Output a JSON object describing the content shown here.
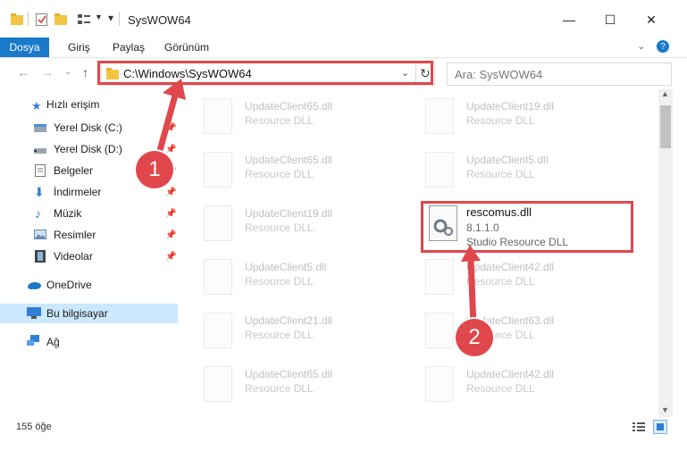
{
  "window": {
    "title": "SysWOW64",
    "minimize_glyph": "—",
    "maximize_glyph": "☐",
    "close_glyph": "✕"
  },
  "ribbon": {
    "tabs": [
      "Dosya",
      "Giriş",
      "Paylaş",
      "Görünüm"
    ],
    "accent": "#1979ca"
  },
  "address_bar": {
    "path": "C:\\Windows\\SysWOW64"
  },
  "search": {
    "placeholder": "Ara: SysWOW64"
  },
  "sidebar": {
    "quick_access": "Hızlı erişim",
    "items": [
      {
        "label": "Yerel Disk (C:)",
        "icon": "drive-icon"
      },
      {
        "label": "Yerel Disk (D:)",
        "icon": "drive-icon"
      },
      {
        "label": "Belgeler",
        "icon": "documents-icon"
      },
      {
        "label": "İndirmeler",
        "icon": "download-icon"
      },
      {
        "label": "Müzik",
        "icon": "music-icon"
      },
      {
        "label": "Resimler",
        "icon": "pictures-icon"
      },
      {
        "label": "Videolar",
        "icon": "video-icon"
      }
    ],
    "onedrive": "OneDrive",
    "this_pc": "Bu bilgisayar",
    "network": "Ağ"
  },
  "files": {
    "left": [
      {
        "name": "UpdateClient65.dll",
        "desc": "Resource DLL"
      },
      {
        "name": "UpdateClient65.dll",
        "desc": "Resource DLL"
      },
      {
        "name": "UpdateClient19.dll",
        "desc": "Resource DLL"
      },
      {
        "name": "UpdateClient5.dll",
        "desc": "Resource DLL"
      },
      {
        "name": "UpdateClient21.dll",
        "desc": "Resource DLL"
      },
      {
        "name": "UpdateClient65.dll",
        "desc": "Resource DLL"
      }
    ],
    "right": [
      {
        "name": "UpdateClient19.dll",
        "desc": "Resource DLL"
      },
      {
        "name": "UpdateClient5.dll",
        "desc": "Resource DLL"
      },
      {
        "name": "UpdateClient42.dll",
        "desc": "Resource DLL"
      },
      {
        "name": "UpdateClient63.dll",
        "desc": "Resource DLL"
      },
      {
        "name": "UpdateClient42.dll",
        "desc": "Resource DLL"
      }
    ],
    "highlighted": {
      "name": "rescomus.dll",
      "version": "8.1.1.0",
      "desc": "Studio Resource DLL"
    }
  },
  "status": {
    "count": "155 öğe"
  },
  "annotations": {
    "step1": "1",
    "step2": "2",
    "color": "#e0474c"
  }
}
